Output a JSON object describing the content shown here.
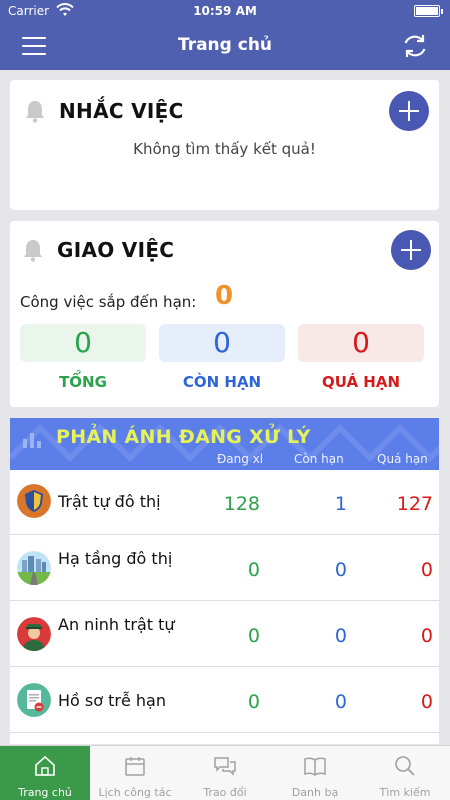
{
  "status_bar": {
    "carrier": "Carrier",
    "time": "10:59 AM"
  },
  "nav": {
    "title": "Trang chủ",
    "menu_icon": "hamburger-menu-icon",
    "refresh_icon": "refresh-icon"
  },
  "reminders": {
    "title": "NHẮC VIỆC",
    "empty_text": "Không tìm thấy kết quả!"
  },
  "assignments": {
    "title": "GIAO VIỆC",
    "due_label": "Công việc sắp đến hạn:",
    "due_count": "0",
    "stats": [
      {
        "label": "TỔNG",
        "value": "0",
        "color": "#2ba24c",
        "bg": "#eaf6ec"
      },
      {
        "label": "CÒN HẠN",
        "value": "0",
        "color": "#2d64d8",
        "bg": "#e6eefb"
      },
      {
        "label": "QUÁ HẠN",
        "value": "0",
        "color": "#d61a1a",
        "bg": "#f8e8e8"
      }
    ]
  },
  "feedback": {
    "title": "PHẢN ÁNH ĐANG XỬ LÝ",
    "columns": [
      "Đang xl",
      "Còn hạn",
      "Quá hạn"
    ],
    "rows": [
      {
        "label": "Trật tự đô thị",
        "icon": "shield-icon",
        "processing": "128",
        "in_time": "1",
        "overdue": "127"
      },
      {
        "label": "Hạ tầng đô thị",
        "icon": "city-road-icon",
        "processing": "0",
        "in_time": "0",
        "overdue": "0"
      },
      {
        "label": "An ninh trật tự",
        "icon": "police-officer-icon",
        "processing": "0",
        "in_time": "0",
        "overdue": "0"
      },
      {
        "label": "Hồ sơ trễ hạn",
        "icon": "overdue-document-icon",
        "processing": "0",
        "in_time": "0",
        "overdue": "0"
      }
    ]
  },
  "tabs": [
    {
      "label": "Trang chủ",
      "icon": "home-icon",
      "active": true
    },
    {
      "label": "Lịch công tác",
      "icon": "calendar-icon",
      "active": false
    },
    {
      "label": "Trao đổi",
      "icon": "chat-icon",
      "active": false
    },
    {
      "label": "Danh bạ",
      "icon": "contacts-book-icon",
      "active": false
    },
    {
      "label": "Tìm kiếm",
      "icon": "search-icon",
      "active": false
    }
  ]
}
